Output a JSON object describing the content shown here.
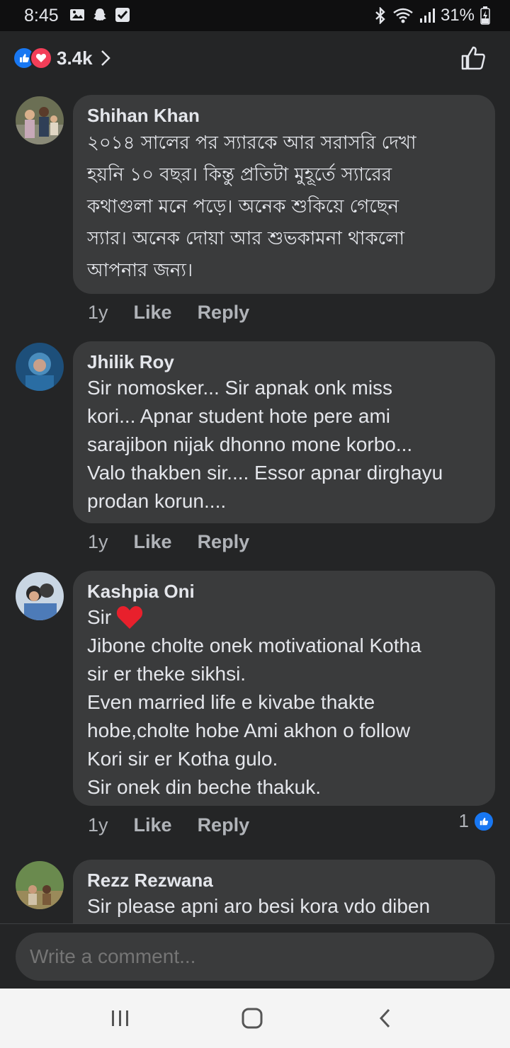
{
  "status": {
    "time": "8:45",
    "battery": "31%"
  },
  "header": {
    "reaction_count": "3.4k"
  },
  "comments": [
    {
      "author": "Shihan Khan",
      "text": "২০১৪ সালের পর স্যারকে আর সরাসরি দেখা\nহয়নি ১০ বছর। কিন্তু প্রতিটা মুহূর্তে স্যারের\nকথাগুলা মনে পড়ে। অনেক শুকিয়ে গেছেন\nস্যার। অনেক দোয়া আর শুভকামনা থাকলো\nআপনার জন্য।",
      "time": "1y",
      "like_label": "Like",
      "reply_label": "Reply"
    },
    {
      "author": "Jhilik Roy",
      "text": "Sir nomosker...  Sir apnak onk miss\nkori... Apnar student hote pere ami\nsarajibon nijak dhonno mone korbo...\nValo thakben sir.... Essor apnar dirghayu\nprodan korun....",
      "time": "1y",
      "like_label": "Like",
      "reply_label": "Reply"
    },
    {
      "author": "Kashpia Oni",
      "text_first": "Sir",
      "text": "Jibone cholte onek motivational Kotha\nsir er theke sikhsi.\nEven married life e kivabe thakte\nhobe,cholte hobe Ami akhon o follow\nKori sir er Kotha gulo.\nSir onek din beche thakuk.",
      "time": "1y",
      "like_label": "Like",
      "reply_label": "Reply",
      "likes": "1"
    },
    {
      "author": "Rezz Rezwana",
      "text": "Sir please apni aro besi kora vdo diben"
    }
  ],
  "composer": {
    "placeholder": "Write a comment..."
  },
  "colors": {
    "background": "#242526",
    "bubble": "#3a3b3c",
    "like_blue": "#1877f2",
    "love_red": "#f33e58"
  }
}
